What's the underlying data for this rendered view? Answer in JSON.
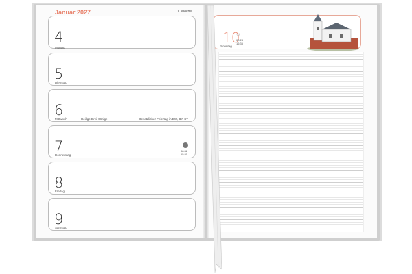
{
  "header": {
    "month": "Januar 2027",
    "week": "1. Woche"
  },
  "days": [
    {
      "num": "4",
      "weekday": "Montag"
    },
    {
      "num": "5",
      "weekday": "Dienstag"
    },
    {
      "num": "6",
      "weekday": "Mittwoch",
      "holiday": "Heilige Drei Könige",
      "note": "Gesetzlicher Feiertag in BW, BY, ST"
    },
    {
      "num": "7",
      "weekday": "Donnerstag",
      "moon_rise": "08:38",
      "moon_set": "15:20"
    },
    {
      "num": "8",
      "weekday": "Freitag"
    },
    {
      "num": "9",
      "weekday": "Samstag"
    }
  ],
  "sunday": {
    "num": "10",
    "weekday": "Sonntag",
    "sunrise": "08:24",
    "sunset": "16:35"
  },
  "colors": {
    "accent": "#e8806a",
    "ribbon": "#eeeeee"
  },
  "icons": {
    "sun": "sun-icon",
    "moon": "new-moon-icon"
  }
}
